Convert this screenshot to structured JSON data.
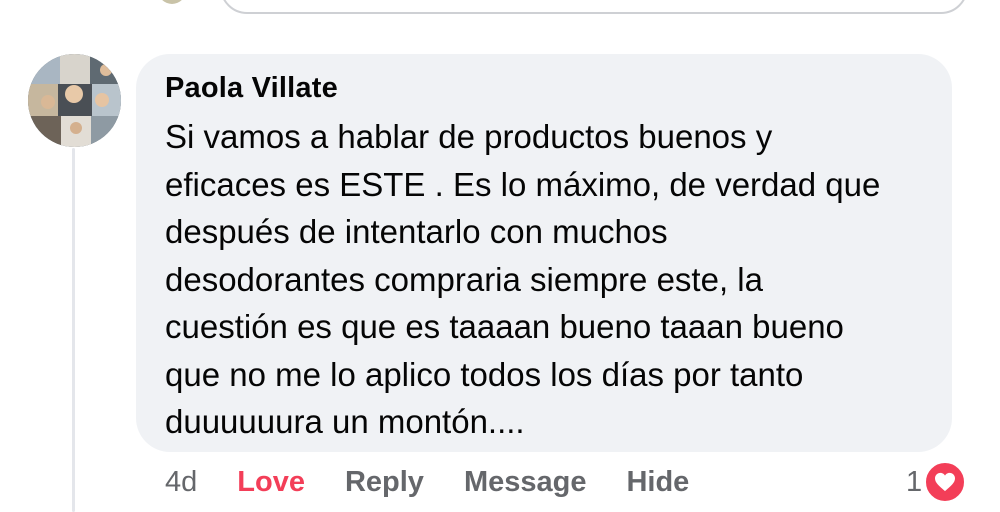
{
  "comment": {
    "author": "Paola Villate",
    "text_lines": [
      "Si vamos a hablar de productos buenos y",
      "eficaces es ESTE . Es lo máximo, de verdad que",
      "después de intentarlo con muchos",
      "desodorantes compraria siempre este, la",
      "cuestión es que es taaaan bueno taaan bueno",
      "que no me lo aplico todos los días por tanto",
      "duuuuuura un montón...."
    ],
    "timestamp": "4d",
    "actions": {
      "love": "Love",
      "reply": "Reply",
      "message": "Message",
      "hide": "Hide"
    },
    "reactions": {
      "count": "1",
      "icon": "heart-icon"
    }
  },
  "colors": {
    "bubble_bg": "#f0f2f5",
    "text": "#050505",
    "secondary_text": "#65676b",
    "love_accent": "#f33e58",
    "thread_line": "#e4e6eb"
  }
}
